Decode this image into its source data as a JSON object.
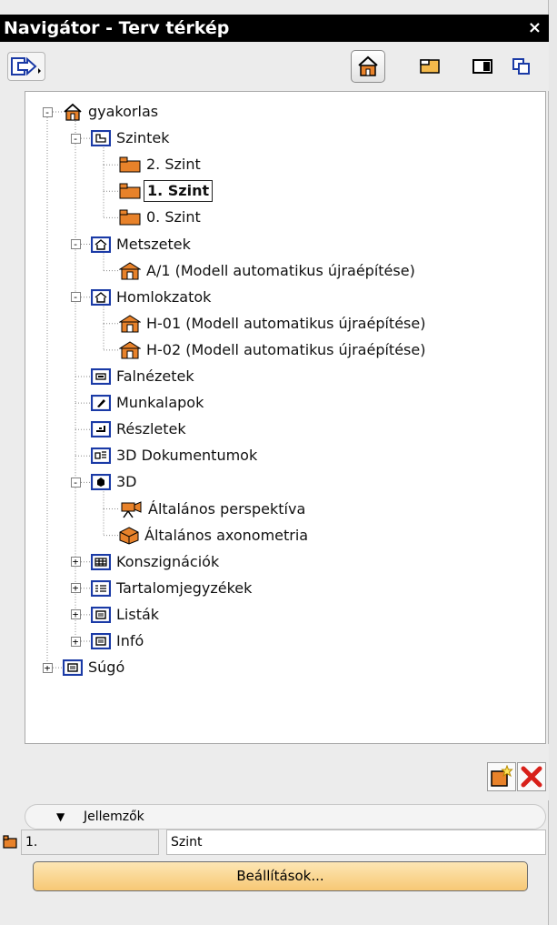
{
  "window": {
    "title": "Navigátor - Terv térkép",
    "close_glyph": "×"
  },
  "toolbar": {
    "send_icon": "send-to-layout-icon",
    "views": [
      {
        "icon": "project-map-icon",
        "active": true
      },
      {
        "icon": "view-map-icon",
        "active": false
      },
      {
        "icon": "layout-book-icon",
        "active": false
      },
      {
        "icon": "publisher-sets-icon",
        "active": false
      }
    ]
  },
  "tree": {
    "nodes": [
      {
        "label": "gyakorlas",
        "icon": "house-icon",
        "expander": "-"
      },
      {
        "label": "Szintek",
        "icon": "stories-icon",
        "expander": "-"
      },
      {
        "label": "2. Szint",
        "icon": "story-icon"
      },
      {
        "label": "1. Szint",
        "icon": "story-icon",
        "selected": true
      },
      {
        "label": "0. Szint",
        "icon": "story-icon"
      },
      {
        "label": "Metszetek",
        "icon": "sections-icon",
        "expander": "-"
      },
      {
        "label": "A/1 (Modell automatikus újraépítése)",
        "icon": "section-house-icon"
      },
      {
        "label": "Homlokzatok",
        "icon": "elevations-icon",
        "expander": "-"
      },
      {
        "label": "H-01 (Modell automatikus újraépítése)",
        "icon": "elevation-house-icon"
      },
      {
        "label": "H-02 (Modell automatikus újraépítése)",
        "icon": "elevation-house-icon"
      },
      {
        "label": "Falnézetek",
        "icon": "interior-elevations-icon"
      },
      {
        "label": "Munkalapok",
        "icon": "worksheets-icon"
      },
      {
        "label": "Részletek",
        "icon": "details-icon"
      },
      {
        "label": "3D Dokumentumok",
        "icon": "3d-documents-icon"
      },
      {
        "label": "3D",
        "icon": "3d-folder-icon",
        "expander": "-"
      },
      {
        "label": "Általános perspektíva",
        "icon": "perspective-camera-icon"
      },
      {
        "label": "Általános axonometria",
        "icon": "axonometry-icon"
      },
      {
        "label": "Konszignációk",
        "icon": "schedules-icon",
        "expander": "+"
      },
      {
        "label": "Tartalomjegyzékek",
        "icon": "project-indexes-icon",
        "expander": "+"
      },
      {
        "label": "Listák",
        "icon": "lists-icon",
        "expander": "+"
      },
      {
        "label": "Infó",
        "icon": "info-icon",
        "expander": "+"
      },
      {
        "label": "Súgó",
        "icon": "help-icon",
        "expander": "+"
      }
    ]
  },
  "actions": {
    "new_icon": "new-view-icon",
    "delete_icon": "delete-icon"
  },
  "properties": {
    "header": "Jellemzők",
    "toggle_glyph": "▼",
    "id_value": "1.",
    "name_value": "Szint",
    "settings_label": "Beállítások..."
  },
  "colors": {
    "icon_orange": "#e8822a",
    "icon_blue": "#1a3aa6",
    "delete_red": "#d8201a"
  }
}
